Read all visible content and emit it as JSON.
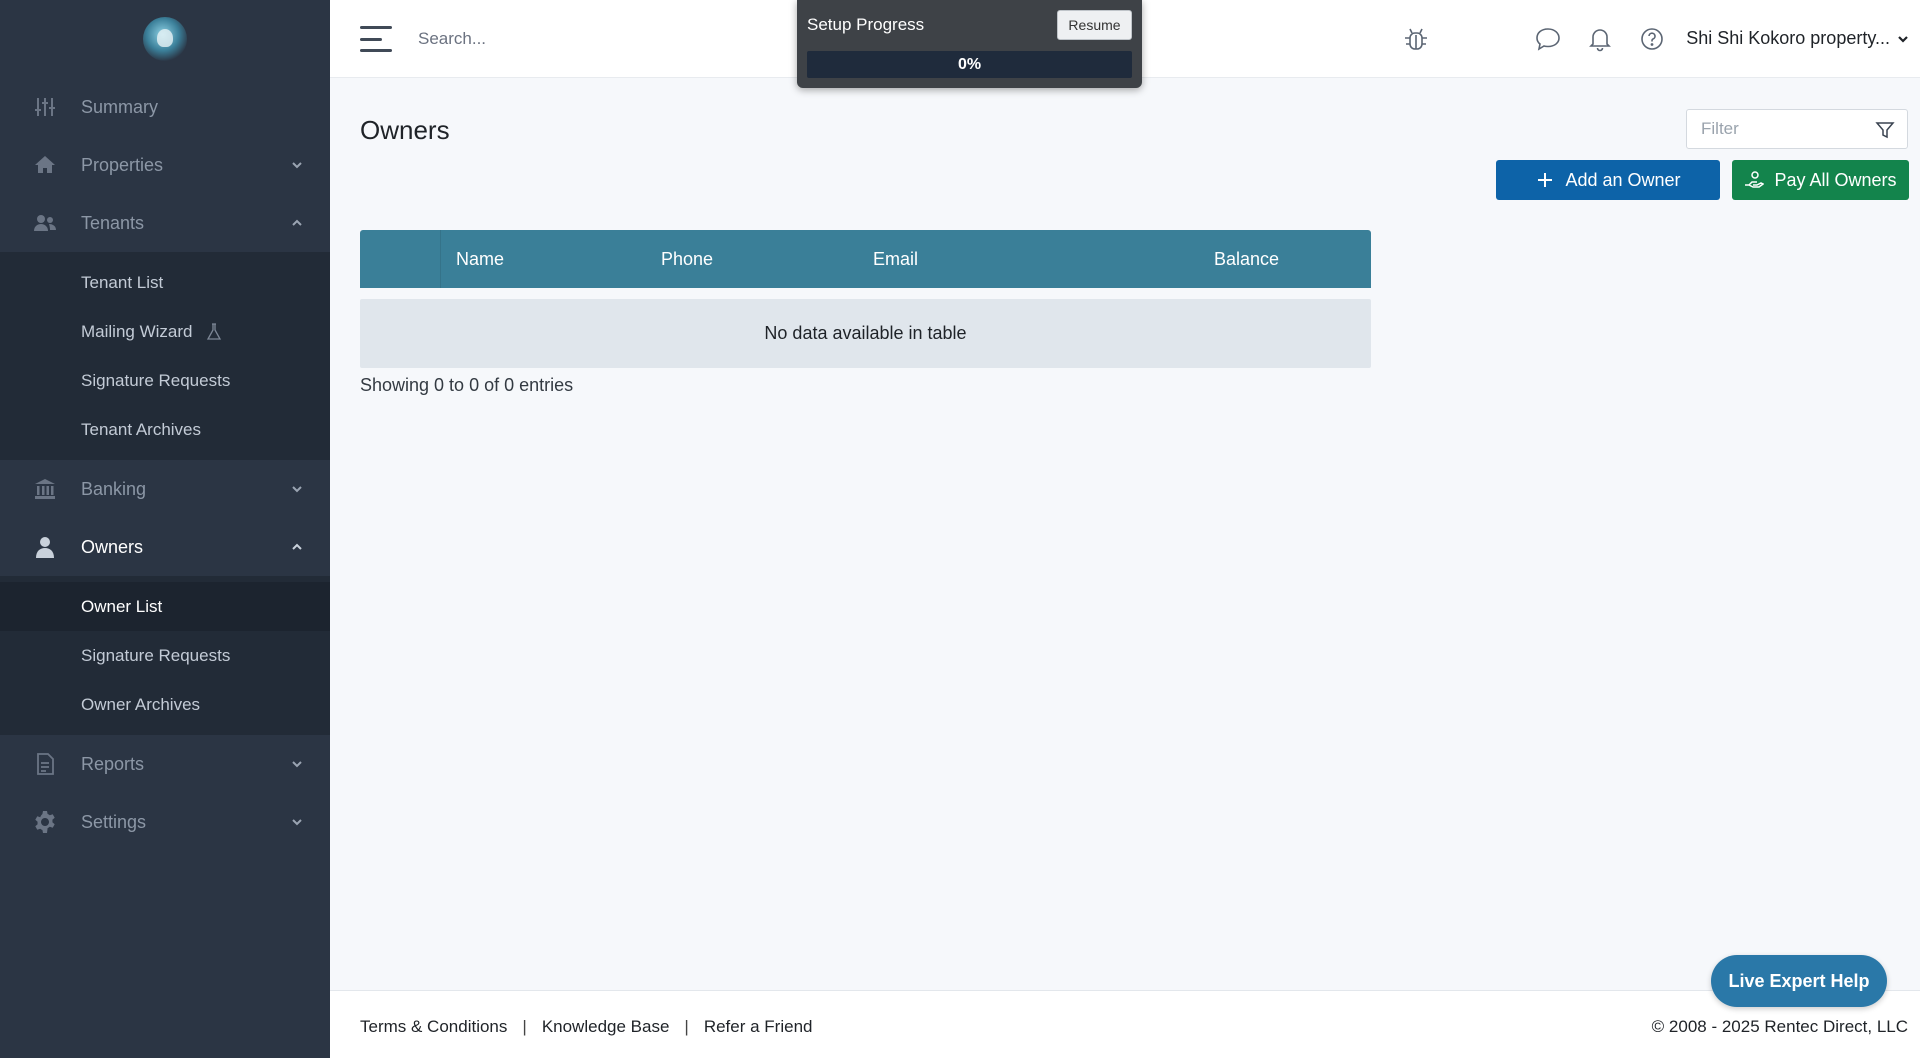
{
  "sidebar": {
    "items": [
      {
        "label": "Summary",
        "icon": "sliders-icon"
      },
      {
        "label": "Properties",
        "icon": "home-icon"
      },
      {
        "label": "Tenants",
        "icon": "users-icon",
        "sub": [
          "Tenant List",
          "Mailing Wizard",
          "Signature Requests",
          "Tenant Archives"
        ]
      },
      {
        "label": "Banking",
        "icon": "bank-icon"
      },
      {
        "label": "Owners",
        "icon": "owner-icon",
        "sub": [
          "Owner List",
          "Signature Requests",
          "Owner Archives"
        ]
      },
      {
        "label": "Reports",
        "icon": "document-icon"
      },
      {
        "label": "Settings",
        "icon": "gear-icon"
      }
    ]
  },
  "topbar": {
    "search_placeholder": "Search...",
    "account_name": "Shi Shi Kokoro property..."
  },
  "setup": {
    "title": "Setup Progress",
    "resume_label": "Resume",
    "progress_value": 0,
    "progress_label": "0%"
  },
  "main": {
    "title": "Owners",
    "filter_placeholder": "Filter",
    "add_owner_label": "Add an Owner",
    "pay_all_label": "Pay All Owners",
    "table": {
      "columns": [
        "Name",
        "Phone",
        "Email",
        "Balance"
      ],
      "empty_text": "No data available in table"
    },
    "entries_text": "Showing 0 to 0 of 0 entries"
  },
  "footer": {
    "links": [
      "Terms & Conditions",
      "Knowledge Base",
      "Refer a Friend"
    ],
    "separator": "|",
    "copyright": "© 2008 - 2025 Rentec Direct, LLC"
  },
  "live_help_label": "Live Expert Help",
  "colors": {
    "sidebar_bg": "#2b3544",
    "table_header": "#3a7f98",
    "add_button": "#0d63a8",
    "pay_button": "#13844c",
    "live_help": "#2a78a8"
  }
}
